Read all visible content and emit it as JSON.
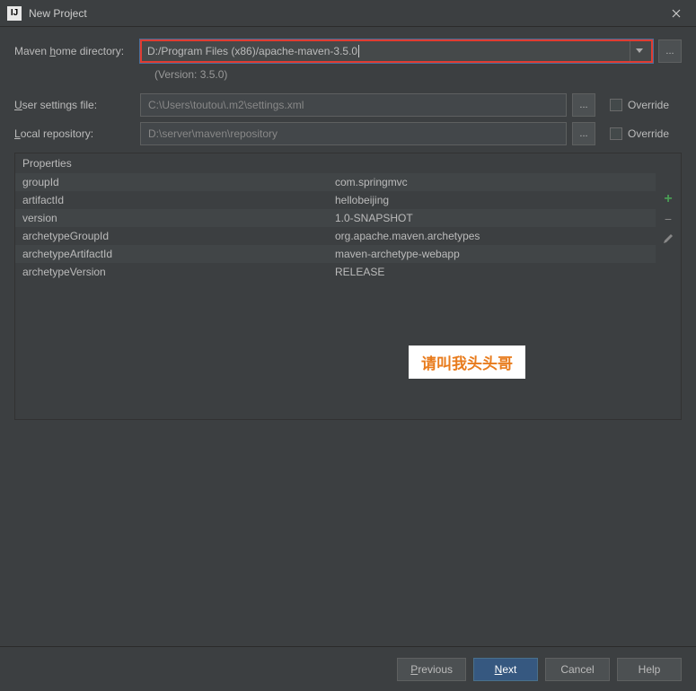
{
  "window": {
    "title": "New Project",
    "icon_text": "IJ"
  },
  "form": {
    "maven_home_label_pre": "Maven ",
    "maven_home_label_u": "h",
    "maven_home_label_post": "ome directory:",
    "maven_home_value": "D:/Program Files (x86)/apache-maven-3.5.0",
    "version_text": "(Version: 3.5.0)",
    "user_settings_label_pre": "",
    "user_settings_label_u": "U",
    "user_settings_label_post": "ser settings file:",
    "user_settings_value": "C:\\Users\\toutou\\.m2\\settings.xml",
    "local_repo_label_pre": "",
    "local_repo_label_u": "L",
    "local_repo_label_post": "ocal repository:",
    "local_repo_value": "D:\\server\\maven\\repository",
    "override_label": "Override"
  },
  "properties": {
    "header": "Properties",
    "rows": [
      {
        "key": "groupId",
        "value": "com.springmvc"
      },
      {
        "key": "artifactId",
        "value": "hellobeijing"
      },
      {
        "key": "version",
        "value": "1.0-SNAPSHOT"
      },
      {
        "key": "archetypeGroupId",
        "value": "org.apache.maven.archetypes"
      },
      {
        "key": "archetypeArtifactId",
        "value": "maven-archetype-webapp"
      },
      {
        "key": "archetypeVersion",
        "value": "RELEASE"
      }
    ]
  },
  "watermark": "请叫我头头哥",
  "buttons": {
    "previous_pre": "",
    "previous_u": "P",
    "previous_post": "revious",
    "next_pre": "",
    "next_u": "N",
    "next_post": "ext",
    "cancel": "Cancel",
    "help": "Help",
    "ellipsis": "..."
  }
}
